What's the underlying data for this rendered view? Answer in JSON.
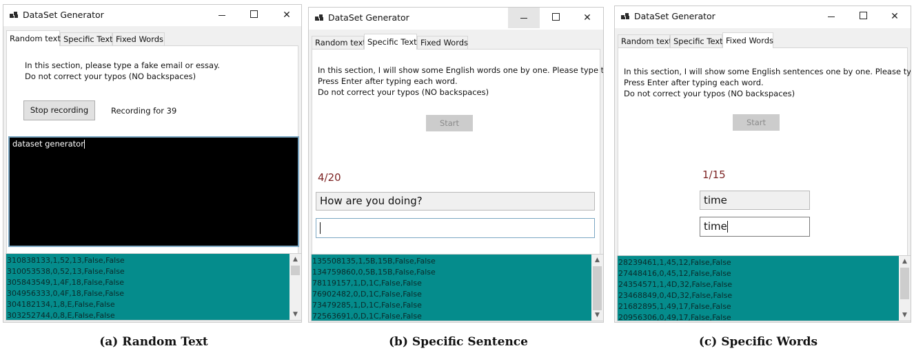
{
  "windows": [
    {
      "title": "DataSet Generator",
      "tabs": [
        "Random text",
        "Specific Text",
        "Fixed Words"
      ],
      "active_tab": 0,
      "instructions": [
        "In this section, please type a fake email or essay.",
        "Do not correct your typos (NO backspaces)"
      ],
      "button_label": "Stop recording",
      "status": "Recording for 39",
      "typed_text": "dataset generator",
      "log_rows": [
        "310838133,1,52,13,False,False",
        "310053538,0,52,13,False,False",
        "305843549,1,4F,18,False,False",
        "304956333,0,4F,18,False,False",
        "304182134,1,8,E,False,False",
        "303252744,0,8,E,False,False"
      ]
    },
    {
      "title": "DataSet Generator",
      "tabs": [
        "Random text",
        "Specific Text",
        "Fixed Words"
      ],
      "active_tab": 1,
      "instructions": [
        "In this section, I will show some English words one by one. Please type them.",
        "Press Enter after typing each word.",
        "Do not correct your typos (NO backspaces)"
      ],
      "button_label": "Start",
      "counter": "4/20",
      "prompt_text": "How are you doing?",
      "input_value": "",
      "log_rows": [
        "135508135,1,5B,15B,False,False",
        "134759860,0,5B,15B,False,False",
        "78119157,1,D,1C,False,False",
        "76902482,0,D,1C,False,False",
        "73479285,1,D,1C,False,False",
        "72563691,0,D,1C,False,False"
      ]
    },
    {
      "title": "DataSet Generator",
      "tabs": [
        "Random text",
        "Specific Text",
        "Fixed Words"
      ],
      "active_tab": 2,
      "instructions": [
        "In this section, I will show some English sentences one by one. Please type them",
        "Press Enter after typing each word.",
        "Do not correct your typos (NO backspaces)"
      ],
      "button_label": "Start",
      "counter": "1/15",
      "prompt_text": "time",
      "input_value": "time",
      "log_rows": [
        "28239461,1,45,12,False,False",
        "27448416,0,45,12,False,False",
        "24354571,1,4D,32,False,False",
        "23468849,0,4D,32,False,False",
        "21682895,1,49,17,False,False",
        "20956306,0,49,17,False,False"
      ]
    }
  ],
  "captions": [
    "(a) Random Text",
    "(b) Specific Sentence",
    "(c) Specific Words"
  ],
  "colors": {
    "log_bg": "#058c8c",
    "counter": "#7a1f1f",
    "textbox_bg": "#000000"
  }
}
